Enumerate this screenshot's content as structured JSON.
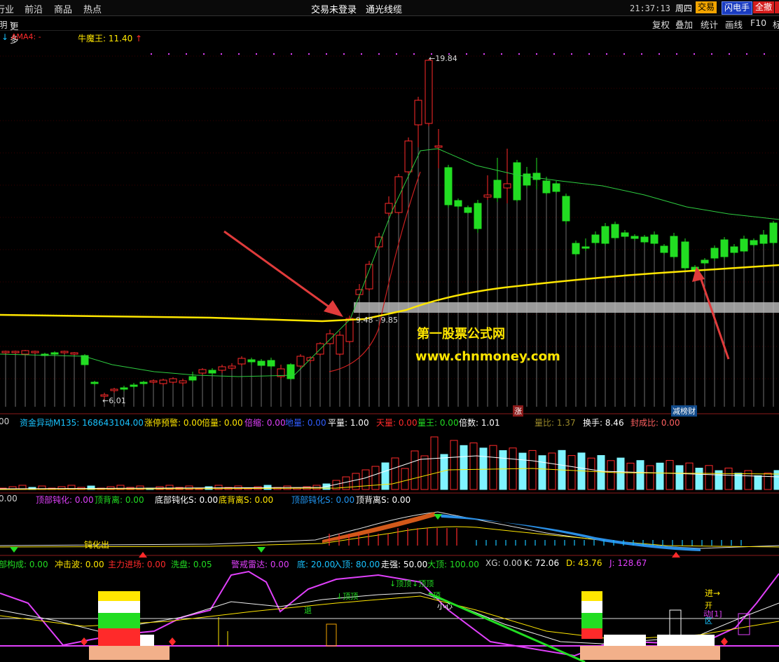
{
  "topbar": {
    "nav": [
      "行业",
      "前沿",
      "商品",
      "热点"
    ],
    "center_left": "交易未登录",
    "center_right": "通光线缆",
    "clock": "21:37:13",
    "weekday": "周四",
    "buttons": [
      "交易",
      "闪电手",
      "全撤"
    ]
  },
  "secbar": {
    "left_a": "明",
    "left_b": "更多",
    "right": [
      "复权",
      "叠加",
      "统计",
      "画线",
      "F10",
      "标"
    ]
  },
  "main_chart": {
    "ama_label": "AMA4: -",
    "niumowang": "牛魔王: 11.40",
    "high_label": "19.84",
    "low_label": "6.01",
    "mid_label": "9.48 - 9.85",
    "zhang_tag": "涨",
    "jianbang_tag": "减榜财",
    "watermark_cn": "第一股票公式网",
    "watermark_url": "www.chnmoney.com"
  },
  "vol_header": {
    "items": [
      {
        "text": "00",
        "color": "#cfcfcf"
      },
      {
        "text": "资金异动M135: 168643104.00",
        "color": "#19c3ff"
      },
      {
        "text": "涨停预警: 0.00",
        "color": "#ffe600"
      },
      {
        "text": "倍量: 0.00",
        "color": "#ffe600"
      },
      {
        "text": "倍缩: 0.00",
        "color": "#e040fb"
      },
      {
        "text": "地量: 0.00",
        "color": "#2f5dff"
      },
      {
        "text": "平量: 1.00",
        "color": "#ffffff"
      },
      {
        "text": "天量: 0.00",
        "color": "#ff2a2a"
      },
      {
        "text": "量王: 0.00",
        "color": "#22dd22"
      },
      {
        "text": "倍数: 1.01",
        "color": "#ffffff"
      },
      {
        "text": "量比: 1.37",
        "color": "#9b8a2a"
      },
      {
        "text": "换手: 8.46",
        "color": "#ffffff"
      },
      {
        "text": "封成比: 0.00",
        "color": "#ff6060"
      }
    ]
  },
  "macd_header": {
    "items": [
      {
        "text": "0.00",
        "color": "#cfcfcf"
      },
      {
        "text": "顶部钝化: 0.00",
        "color": "#e040fb"
      },
      {
        "text": "顶背离: 0.00",
        "color": "#22dd22"
      },
      {
        "text": "底部钝化S: 0.00",
        "color": "#ffffff"
      },
      {
        "text": "底背离S: 0.00",
        "color": "#ffe600"
      },
      {
        "text": "顶部钝化S: 0.00",
        "color": "#2196f3"
      },
      {
        "text": "顶背离S: 0.00",
        "color": "#ffffff"
      }
    ],
    "dunhua_label": "钝化出"
  },
  "kdj_header": {
    "items": [
      {
        "text": "部构成: 0.00",
        "color": "#22dd22"
      },
      {
        "text": "冲击波: 0.00",
        "color": "#ffe600"
      },
      {
        "text": "主力进场: 0.00",
        "color": "#ff2a2a"
      },
      {
        "text": "洗盘: 0.05",
        "color": "#22dd22"
      },
      {
        "text": "警戒雷达: 0.00",
        "color": "#e040fb"
      },
      {
        "text": "底: 20.00",
        "color": "#19c3ff"
      },
      {
        "text": "入顶: 80.00",
        "color": "#19c3ff"
      },
      {
        "text": "走强: 50.00",
        "color": "#ffffff"
      },
      {
        "text": "大顶: 100.00",
        "color": "#22dd22"
      },
      {
        "text": "XG: 0.00",
        "color": "#cfcfcf"
      },
      {
        "text": "K: 72.06",
        "color": "#ffffff"
      },
      {
        "text": "D: 43.76",
        "color": "#ffe600"
      },
      {
        "text": "J: 128.67",
        "color": "#e040fb"
      }
    ],
    "ding_labels": [
      "顶",
      "顶",
      "顶顶",
      "顶",
      "顶顶",
      "顶"
    ],
    "small_labels": [
      "小心",
      "退",
      "进",
      "开",
      "动[1]",
      "区"
    ]
  },
  "colors": {
    "up": "#ff2a2a",
    "down": "#22dd22",
    "ma_yellow": "#ffe600",
    "band_gray": "#9a9a9a",
    "divider": "#8b1a1a"
  }
}
